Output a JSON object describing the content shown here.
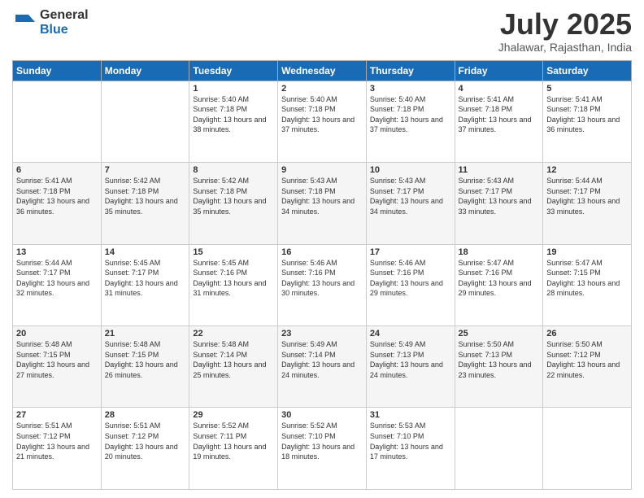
{
  "logo": {
    "general": "General",
    "blue": "Blue"
  },
  "header": {
    "month": "July 2025",
    "location": "Jhalawar, Rajasthan, India"
  },
  "weekdays": [
    "Sunday",
    "Monday",
    "Tuesday",
    "Wednesday",
    "Thursday",
    "Friday",
    "Saturday"
  ],
  "weeks": [
    [
      {
        "day": "",
        "sunrise": "",
        "sunset": "",
        "daylight": ""
      },
      {
        "day": "",
        "sunrise": "",
        "sunset": "",
        "daylight": ""
      },
      {
        "day": "1",
        "sunrise": "Sunrise: 5:40 AM",
        "sunset": "Sunset: 7:18 PM",
        "daylight": "Daylight: 13 hours and 38 minutes."
      },
      {
        "day": "2",
        "sunrise": "Sunrise: 5:40 AM",
        "sunset": "Sunset: 7:18 PM",
        "daylight": "Daylight: 13 hours and 37 minutes."
      },
      {
        "day": "3",
        "sunrise": "Sunrise: 5:40 AM",
        "sunset": "Sunset: 7:18 PM",
        "daylight": "Daylight: 13 hours and 37 minutes."
      },
      {
        "day": "4",
        "sunrise": "Sunrise: 5:41 AM",
        "sunset": "Sunset: 7:18 PM",
        "daylight": "Daylight: 13 hours and 37 minutes."
      },
      {
        "day": "5",
        "sunrise": "Sunrise: 5:41 AM",
        "sunset": "Sunset: 7:18 PM",
        "daylight": "Daylight: 13 hours and 36 minutes."
      }
    ],
    [
      {
        "day": "6",
        "sunrise": "Sunrise: 5:41 AM",
        "sunset": "Sunset: 7:18 PM",
        "daylight": "Daylight: 13 hours and 36 minutes."
      },
      {
        "day": "7",
        "sunrise": "Sunrise: 5:42 AM",
        "sunset": "Sunset: 7:18 PM",
        "daylight": "Daylight: 13 hours and 35 minutes."
      },
      {
        "day": "8",
        "sunrise": "Sunrise: 5:42 AM",
        "sunset": "Sunset: 7:18 PM",
        "daylight": "Daylight: 13 hours and 35 minutes."
      },
      {
        "day": "9",
        "sunrise": "Sunrise: 5:43 AM",
        "sunset": "Sunset: 7:18 PM",
        "daylight": "Daylight: 13 hours and 34 minutes."
      },
      {
        "day": "10",
        "sunrise": "Sunrise: 5:43 AM",
        "sunset": "Sunset: 7:17 PM",
        "daylight": "Daylight: 13 hours and 34 minutes."
      },
      {
        "day": "11",
        "sunrise": "Sunrise: 5:43 AM",
        "sunset": "Sunset: 7:17 PM",
        "daylight": "Daylight: 13 hours and 33 minutes."
      },
      {
        "day": "12",
        "sunrise": "Sunrise: 5:44 AM",
        "sunset": "Sunset: 7:17 PM",
        "daylight": "Daylight: 13 hours and 33 minutes."
      }
    ],
    [
      {
        "day": "13",
        "sunrise": "Sunrise: 5:44 AM",
        "sunset": "Sunset: 7:17 PM",
        "daylight": "Daylight: 13 hours and 32 minutes."
      },
      {
        "day": "14",
        "sunrise": "Sunrise: 5:45 AM",
        "sunset": "Sunset: 7:17 PM",
        "daylight": "Daylight: 13 hours and 31 minutes."
      },
      {
        "day": "15",
        "sunrise": "Sunrise: 5:45 AM",
        "sunset": "Sunset: 7:16 PM",
        "daylight": "Daylight: 13 hours and 31 minutes."
      },
      {
        "day": "16",
        "sunrise": "Sunrise: 5:46 AM",
        "sunset": "Sunset: 7:16 PM",
        "daylight": "Daylight: 13 hours and 30 minutes."
      },
      {
        "day": "17",
        "sunrise": "Sunrise: 5:46 AM",
        "sunset": "Sunset: 7:16 PM",
        "daylight": "Daylight: 13 hours and 29 minutes."
      },
      {
        "day": "18",
        "sunrise": "Sunrise: 5:47 AM",
        "sunset": "Sunset: 7:16 PM",
        "daylight": "Daylight: 13 hours and 29 minutes."
      },
      {
        "day": "19",
        "sunrise": "Sunrise: 5:47 AM",
        "sunset": "Sunset: 7:15 PM",
        "daylight": "Daylight: 13 hours and 28 minutes."
      }
    ],
    [
      {
        "day": "20",
        "sunrise": "Sunrise: 5:48 AM",
        "sunset": "Sunset: 7:15 PM",
        "daylight": "Daylight: 13 hours and 27 minutes."
      },
      {
        "day": "21",
        "sunrise": "Sunrise: 5:48 AM",
        "sunset": "Sunset: 7:15 PM",
        "daylight": "Daylight: 13 hours and 26 minutes."
      },
      {
        "day": "22",
        "sunrise": "Sunrise: 5:48 AM",
        "sunset": "Sunset: 7:14 PM",
        "daylight": "Daylight: 13 hours and 25 minutes."
      },
      {
        "day": "23",
        "sunrise": "Sunrise: 5:49 AM",
        "sunset": "Sunset: 7:14 PM",
        "daylight": "Daylight: 13 hours and 24 minutes."
      },
      {
        "day": "24",
        "sunrise": "Sunrise: 5:49 AM",
        "sunset": "Sunset: 7:13 PM",
        "daylight": "Daylight: 13 hours and 24 minutes."
      },
      {
        "day": "25",
        "sunrise": "Sunrise: 5:50 AM",
        "sunset": "Sunset: 7:13 PM",
        "daylight": "Daylight: 13 hours and 23 minutes."
      },
      {
        "day": "26",
        "sunrise": "Sunrise: 5:50 AM",
        "sunset": "Sunset: 7:12 PM",
        "daylight": "Daylight: 13 hours and 22 minutes."
      }
    ],
    [
      {
        "day": "27",
        "sunrise": "Sunrise: 5:51 AM",
        "sunset": "Sunset: 7:12 PM",
        "daylight": "Daylight: 13 hours and 21 minutes."
      },
      {
        "day": "28",
        "sunrise": "Sunrise: 5:51 AM",
        "sunset": "Sunset: 7:12 PM",
        "daylight": "Daylight: 13 hours and 20 minutes."
      },
      {
        "day": "29",
        "sunrise": "Sunrise: 5:52 AM",
        "sunset": "Sunset: 7:11 PM",
        "daylight": "Daylight: 13 hours and 19 minutes."
      },
      {
        "day": "30",
        "sunrise": "Sunrise: 5:52 AM",
        "sunset": "Sunset: 7:10 PM",
        "daylight": "Daylight: 13 hours and 18 minutes."
      },
      {
        "day": "31",
        "sunrise": "Sunrise: 5:53 AM",
        "sunset": "Sunset: 7:10 PM",
        "daylight": "Daylight: 13 hours and 17 minutes."
      },
      {
        "day": "",
        "sunrise": "",
        "sunset": "",
        "daylight": ""
      },
      {
        "day": "",
        "sunrise": "",
        "sunset": "",
        "daylight": ""
      }
    ]
  ]
}
